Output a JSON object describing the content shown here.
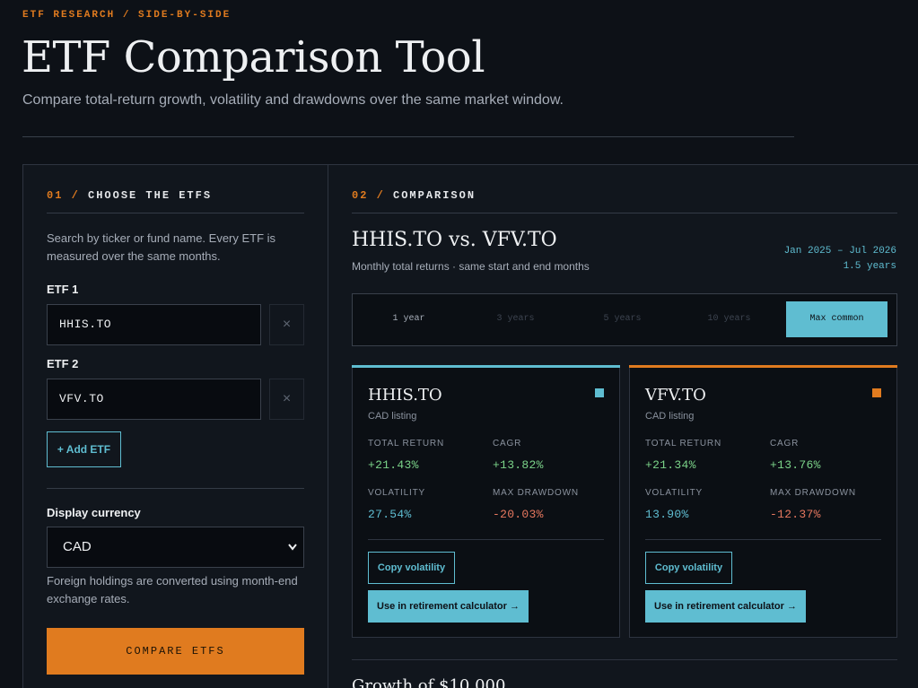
{
  "header": {
    "eyebrow": "ETF RESEARCH / SIDE-BY-SIDE",
    "title": "ETF Comparison Tool",
    "subtitle": "Compare total-return growth, volatility and drawdowns over the same market window."
  },
  "left": {
    "section_num": "01 /",
    "section_title": "CHOOSE THE ETFS",
    "help": "Search by ticker or fund name. Every ETF is measured over the same months.",
    "etf1_label": "ETF 1",
    "etf1_value": "HHIS.TO",
    "etf2_label": "ETF 2",
    "etf2_value": "VFV.TO",
    "clear_glyph": "×",
    "add_label": "+ Add ETF",
    "currency_label": "Display currency",
    "currency_value": "CAD",
    "currency_help": "Foreign holdings are converted using month-end exchange rates.",
    "compare_label": "COMPARE ETFS"
  },
  "right": {
    "section_num": "02 /",
    "section_title": "COMPARISON",
    "title": "HHIS.TO vs. VFV.TO",
    "subtitle": "Monthly total returns · same start and end months",
    "range": "Jan 2025 – Jul 2026",
    "duration": "1.5 years",
    "tabs": [
      "1 year",
      "3 years",
      "5 years",
      "10 years",
      "Max common"
    ],
    "active_tab": "Max common",
    "cards": [
      {
        "ticker": "HHIS.TO",
        "listing": "CAD listing",
        "color": "#5fbdd1",
        "total_return_label": "TOTAL RETURN",
        "total_return": "+21.43%",
        "cagr_label": "CAGR",
        "cagr": "+13.82%",
        "volatility_label": "VOLATILITY",
        "volatility": "27.54%",
        "max_drawdown_label": "MAX DRAWDOWN",
        "max_drawdown": "-20.03%",
        "copy_label": "Copy volatility",
        "retire_label": "Use in retirement calculator →"
      },
      {
        "ticker": "VFV.TO",
        "listing": "CAD listing",
        "color": "#e07b1f",
        "total_return_label": "TOTAL RETURN",
        "total_return": "+21.34%",
        "cagr_label": "CAGR",
        "cagr": "+13.76%",
        "volatility_label": "VOLATILITY",
        "volatility": "13.90%",
        "max_drawdown_label": "MAX DRAWDOWN",
        "max_drawdown": "-12.37%",
        "copy_label": "Copy volatility",
        "retire_label": "Use in retirement calculator →"
      }
    ],
    "growth_title": "Growth of $10,000"
  }
}
